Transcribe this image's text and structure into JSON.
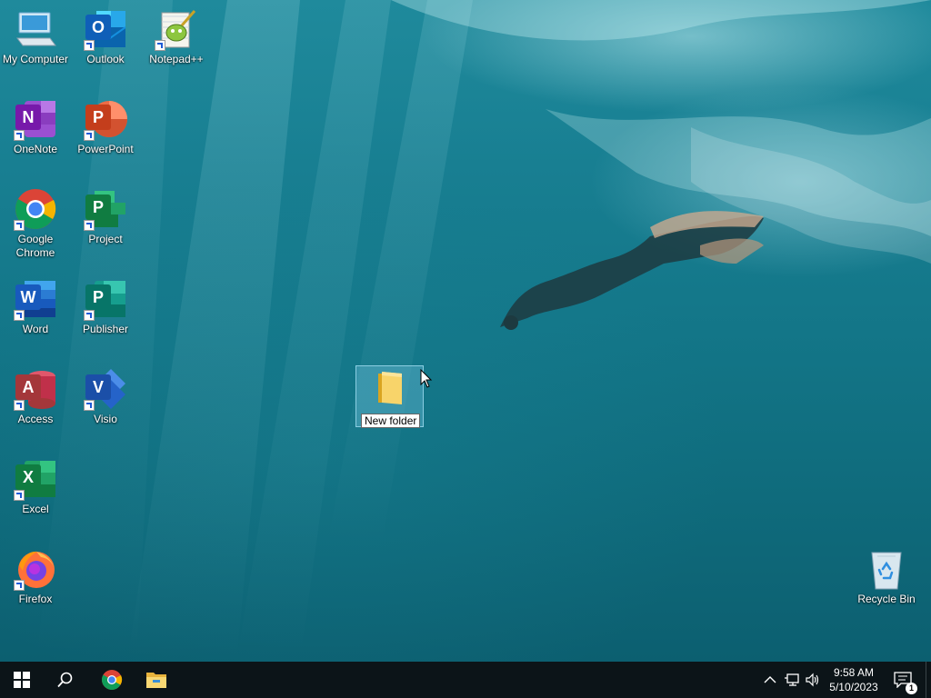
{
  "desktop": {
    "icons": [
      {
        "label": "My Computer",
        "icon": "computer-icon"
      },
      {
        "label": "Outlook",
        "icon": "outlook-icon"
      },
      {
        "label": "Notepad++",
        "icon": "notepadpp-icon"
      },
      {
        "label": "OneNote",
        "icon": "onenote-icon"
      },
      {
        "label": "PowerPoint",
        "icon": "powerpoint-icon"
      },
      {
        "label": "Google Chrome",
        "icon": "chrome-icon"
      },
      {
        "label": "Project",
        "icon": "project-icon"
      },
      {
        "label": "Word",
        "icon": "word-icon"
      },
      {
        "label": "Publisher",
        "icon": "publisher-icon"
      },
      {
        "label": "Access",
        "icon": "access-icon"
      },
      {
        "label": "Visio",
        "icon": "visio-icon"
      },
      {
        "label": "Excel",
        "icon": "excel-icon"
      },
      {
        "label": "Firefox",
        "icon": "firefox-icon"
      },
      {
        "label": "Recycle Bin",
        "icon": "recycle-bin-icon"
      }
    ],
    "new_folder": {
      "label": "New folder",
      "state": "renaming"
    }
  },
  "taskbar": {
    "pinned": [
      "start-icon",
      "search-icon",
      "chrome-icon",
      "file-explorer-icon"
    ],
    "tray_icons": [
      "show-hidden-icons",
      "network-icon",
      "volume-icon"
    ],
    "time": "9:58 AM",
    "date": "5/10/2023",
    "notification_count": "1"
  },
  "colors": {
    "taskbar": "#0c1418",
    "water": "#137688",
    "chrome_red": "#db4437"
  }
}
